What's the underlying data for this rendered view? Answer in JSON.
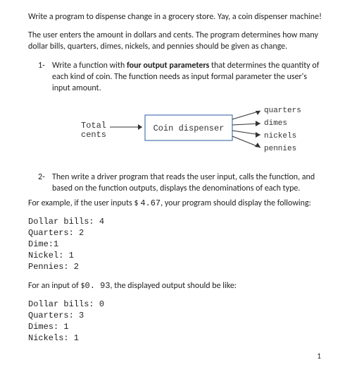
{
  "intro": {
    "p1": "Write a program to dispense change in a grocery store. Yay, a coin dispenser machine!",
    "p2": "The user enters the amount in dollars and cents. The program determines how many dollar bills, quarters, dimes, nickels, and pennies should be given as change."
  },
  "step1": {
    "marker": "1-",
    "text_before_bold": "Write a function with ",
    "bold": "four output parameters",
    "text_after_bold": " that determines the quantity of each kind of coin. The function needs as input formal parameter the user's input amount."
  },
  "diagram": {
    "input_top": "Total",
    "input_bottom": "cents",
    "box_label": "Coin dispenser",
    "outputs": [
      "quarters",
      "dimes",
      "nickels",
      "pennies"
    ]
  },
  "step2": {
    "marker": "2-",
    "text": "Then write a driver program that reads the user input, calls the function, and based on the function outputs, displays the denominations of each type."
  },
  "ex1": {
    "intro_before": "For example, if the user inputs $ ",
    "amount": "4.67",
    "intro_after": ", your program should display the following:",
    "output": "Dollar bills: 4\nQuarters: 2\nDime:1\nNickel: 1\nPennies: 2"
  },
  "ex2": {
    "intro_before": "For an input of $",
    "amount": "0. 93",
    "intro_after": ", the displayed output should be like:",
    "output": "Dollar bills: 0\nQuarters: 3\nDimes: 1\nNickels: 1"
  },
  "footer": {
    "page_number": "1"
  }
}
